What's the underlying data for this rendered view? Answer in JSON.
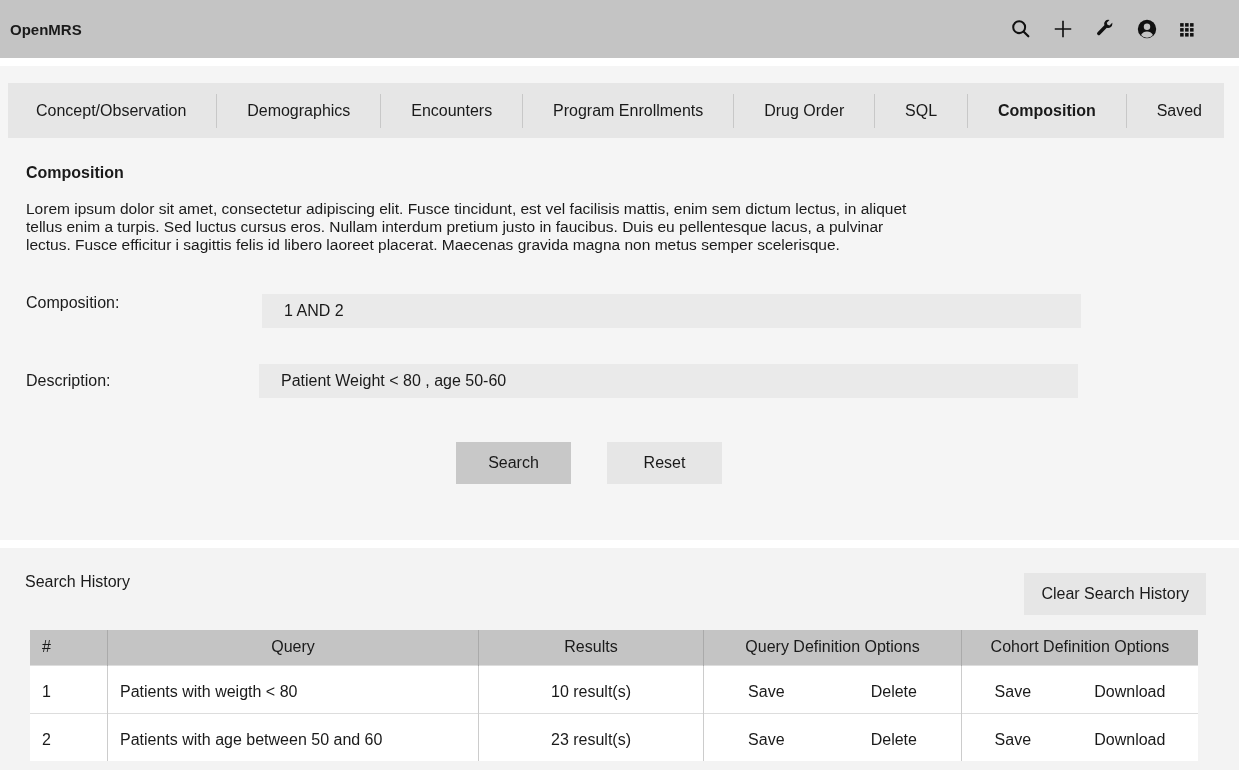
{
  "app_bar": {
    "title": "OpenMRS"
  },
  "tabs": [
    {
      "label": "Concept/Observation",
      "selected": false
    },
    {
      "label": "Demographics",
      "selected": false
    },
    {
      "label": "Encounters",
      "selected": false
    },
    {
      "label": "Program Enrollments",
      "selected": false
    },
    {
      "label": "Drug Order",
      "selected": false
    },
    {
      "label": "SQL",
      "selected": false
    },
    {
      "label": "Composition",
      "selected": true
    },
    {
      "label": "Saved",
      "selected": false
    }
  ],
  "section": {
    "heading": "Composition",
    "description": "Lorem ipsum dolor sit amet, consectetur adipiscing elit. Fusce tincidunt, est vel facilisis mattis, enim sem dictum lectus, in aliquet tellus enim a turpis. Sed luctus cursus eros. Nullam interdum pretium justo in faucibus. Duis eu pellentesque lacus, a pulvinar lectus. Fusce efficitur i sagittis felis id libero laoreet placerat. Maecenas gravida magna non metus semper scelerisque."
  },
  "form": {
    "fields": [
      {
        "label": "Composition:",
        "value": "1 AND 2"
      },
      {
        "label": "Description:",
        "value": "Patient Weight < 80 , age 50-60"
      }
    ],
    "buttons": [
      {
        "label": "Search",
        "kind": "primary"
      },
      {
        "label": "Reset",
        "kind": "secondary"
      }
    ]
  },
  "history": {
    "title": "Search History",
    "clear_button": "Clear Search History",
    "columns": [
      "#",
      "Query",
      "Results",
      "Query Definition Options",
      "Cohort Definition Options"
    ],
    "rows": [
      {
        "number": "1",
        "query": "Patients with weigth < 80",
        "results": "10 result(s)",
        "query_actions": [
          "Save",
          "Delete"
        ],
        "cohort_actions": [
          "Save",
          "Download"
        ]
      },
      {
        "number": "2",
        "query": "Patients with age between 50 and 60",
        "results": "23 result(s)",
        "query_actions": [
          "Save",
          "Delete"
        ],
        "cohort_actions": [
          "Save",
          "Download"
        ]
      }
    ]
  }
}
